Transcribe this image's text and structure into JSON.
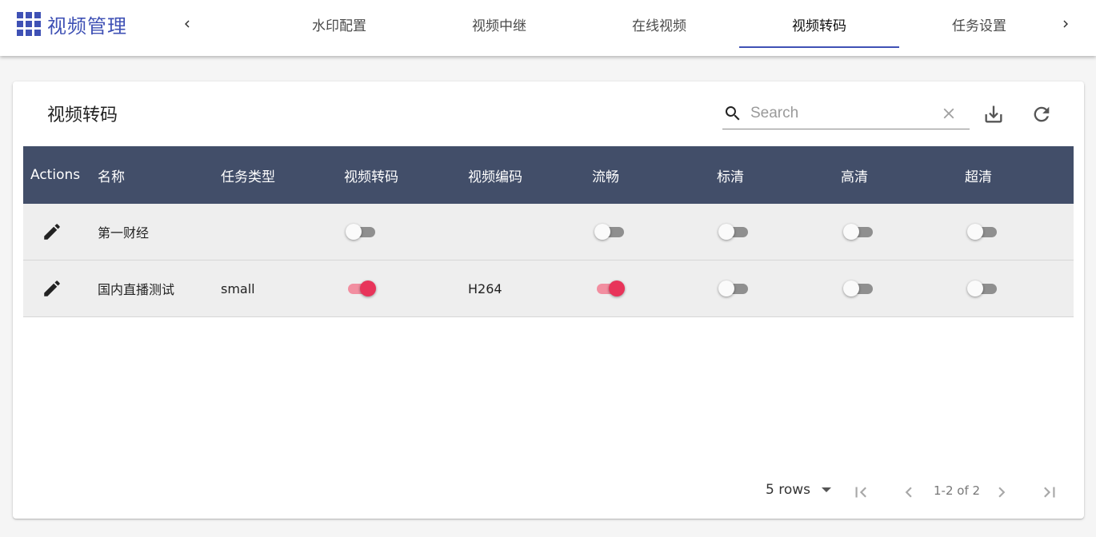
{
  "app": {
    "title": "视频管理"
  },
  "tabs": [
    {
      "label": "水印配置",
      "active": false
    },
    {
      "label": "视频中继",
      "active": false
    },
    {
      "label": "在线视频",
      "active": false
    },
    {
      "label": "视频转码",
      "active": true
    },
    {
      "label": "任务设置",
      "active": false
    }
  ],
  "card": {
    "title": "视频转码",
    "search_placeholder": "Search",
    "search_value": ""
  },
  "table": {
    "columns": [
      "Actions",
      "名称",
      "任务类型",
      "视频转码",
      "视频编码",
      "流畅",
      "标清",
      "高清",
      "超清"
    ],
    "rows": [
      {
        "name": "第一财经",
        "task_type": "",
        "transcode": false,
        "codec": "",
        "smooth": false,
        "sd": false,
        "hd": false,
        "uhd": false
      },
      {
        "name": "国内直播测试",
        "task_type": "small",
        "transcode": true,
        "codec": "H264",
        "smooth": true,
        "sd": false,
        "hd": false,
        "uhd": false
      }
    ]
  },
  "pagination": {
    "rows_per_page": "5 rows",
    "range": "1-2 of 2"
  },
  "colors": {
    "accent": "#3f51b5",
    "header_bg": "#424e69",
    "switch_on": "#e8345a"
  }
}
